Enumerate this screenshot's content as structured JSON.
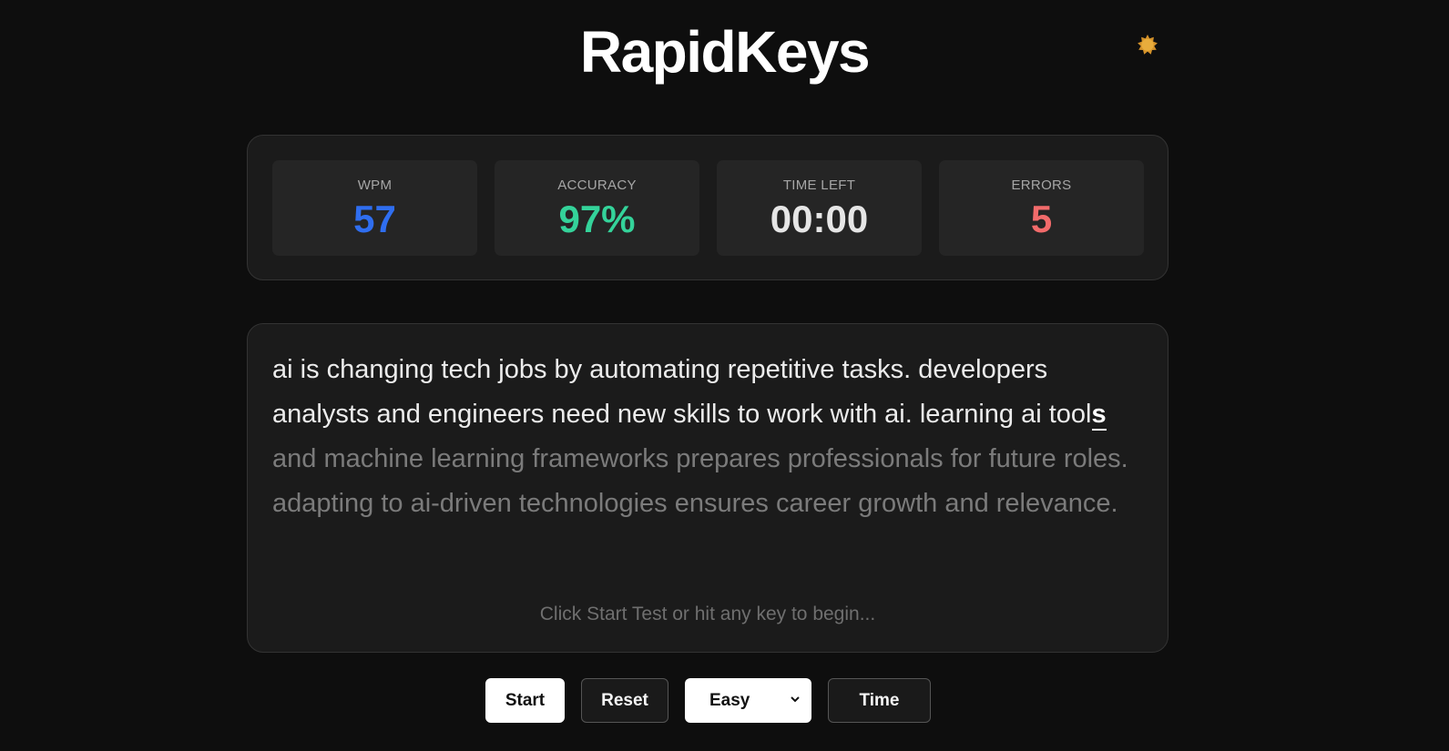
{
  "header": {
    "title": "RapidKeys",
    "theme_icon": "sun-icon"
  },
  "stats": [
    {
      "label": "WPM",
      "value": "57",
      "color": "#2f6ef0"
    },
    {
      "label": "ACCURACY",
      "value": "97%",
      "color": "#34d39a"
    },
    {
      "label": "TIME LEFT",
      "value": "00:00",
      "color": "#e6e6e6"
    },
    {
      "label": "ERRORS",
      "value": "5",
      "color": "#f26b6b"
    }
  ],
  "passage": {
    "typed": "ai is changing tech jobs by automating repetitive tasks. developers analysts and engineers need new skills to work with ai. learning ai tool",
    "current": "s",
    "remaining": " and machine learning frameworks prepares professionals for future roles. adapting to ai-driven technologies ensures career growth and relevance."
  },
  "hint": "Click Start Test or hit any key to begin...",
  "controls": {
    "start_label": "Start",
    "reset_label": "Reset",
    "difficulty": {
      "selected": "Easy"
    },
    "mode_label": "Time"
  }
}
